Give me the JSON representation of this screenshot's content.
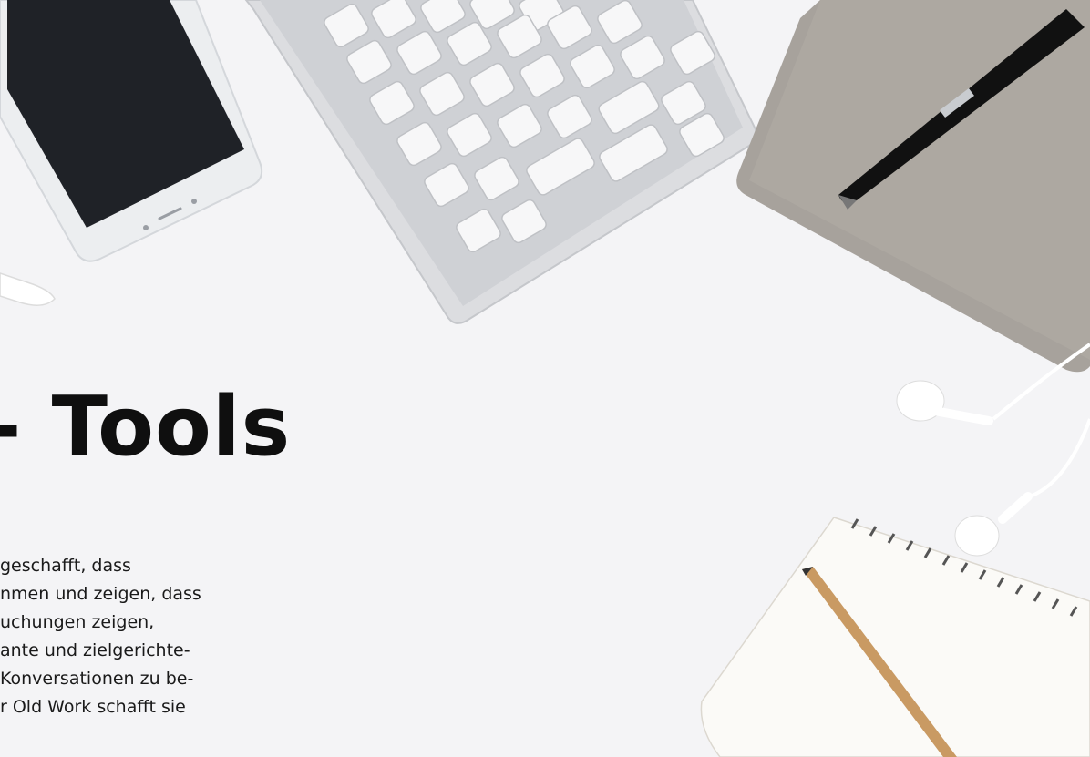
{
  "hero": {
    "headline": "- Tools",
    "body_lines": [
      "geschafft, dass",
      "nmen und zeigen, dass",
      "uchungen zeigen,",
      "ante und zielgerichte-",
      "Konversationen zu be-",
      "r Old Work schafft sie"
    ]
  },
  "photo": {
    "objects": [
      "smartphone",
      "keyboard",
      "notebook",
      "pen",
      "earphones",
      "notepad",
      "pencil"
    ],
    "colors": {
      "background": "#f4f4f6",
      "notebook": "#a7a29c",
      "phone_screen": "#1f2227",
      "pen": "#111111",
      "pencil": "#c99a63"
    }
  }
}
